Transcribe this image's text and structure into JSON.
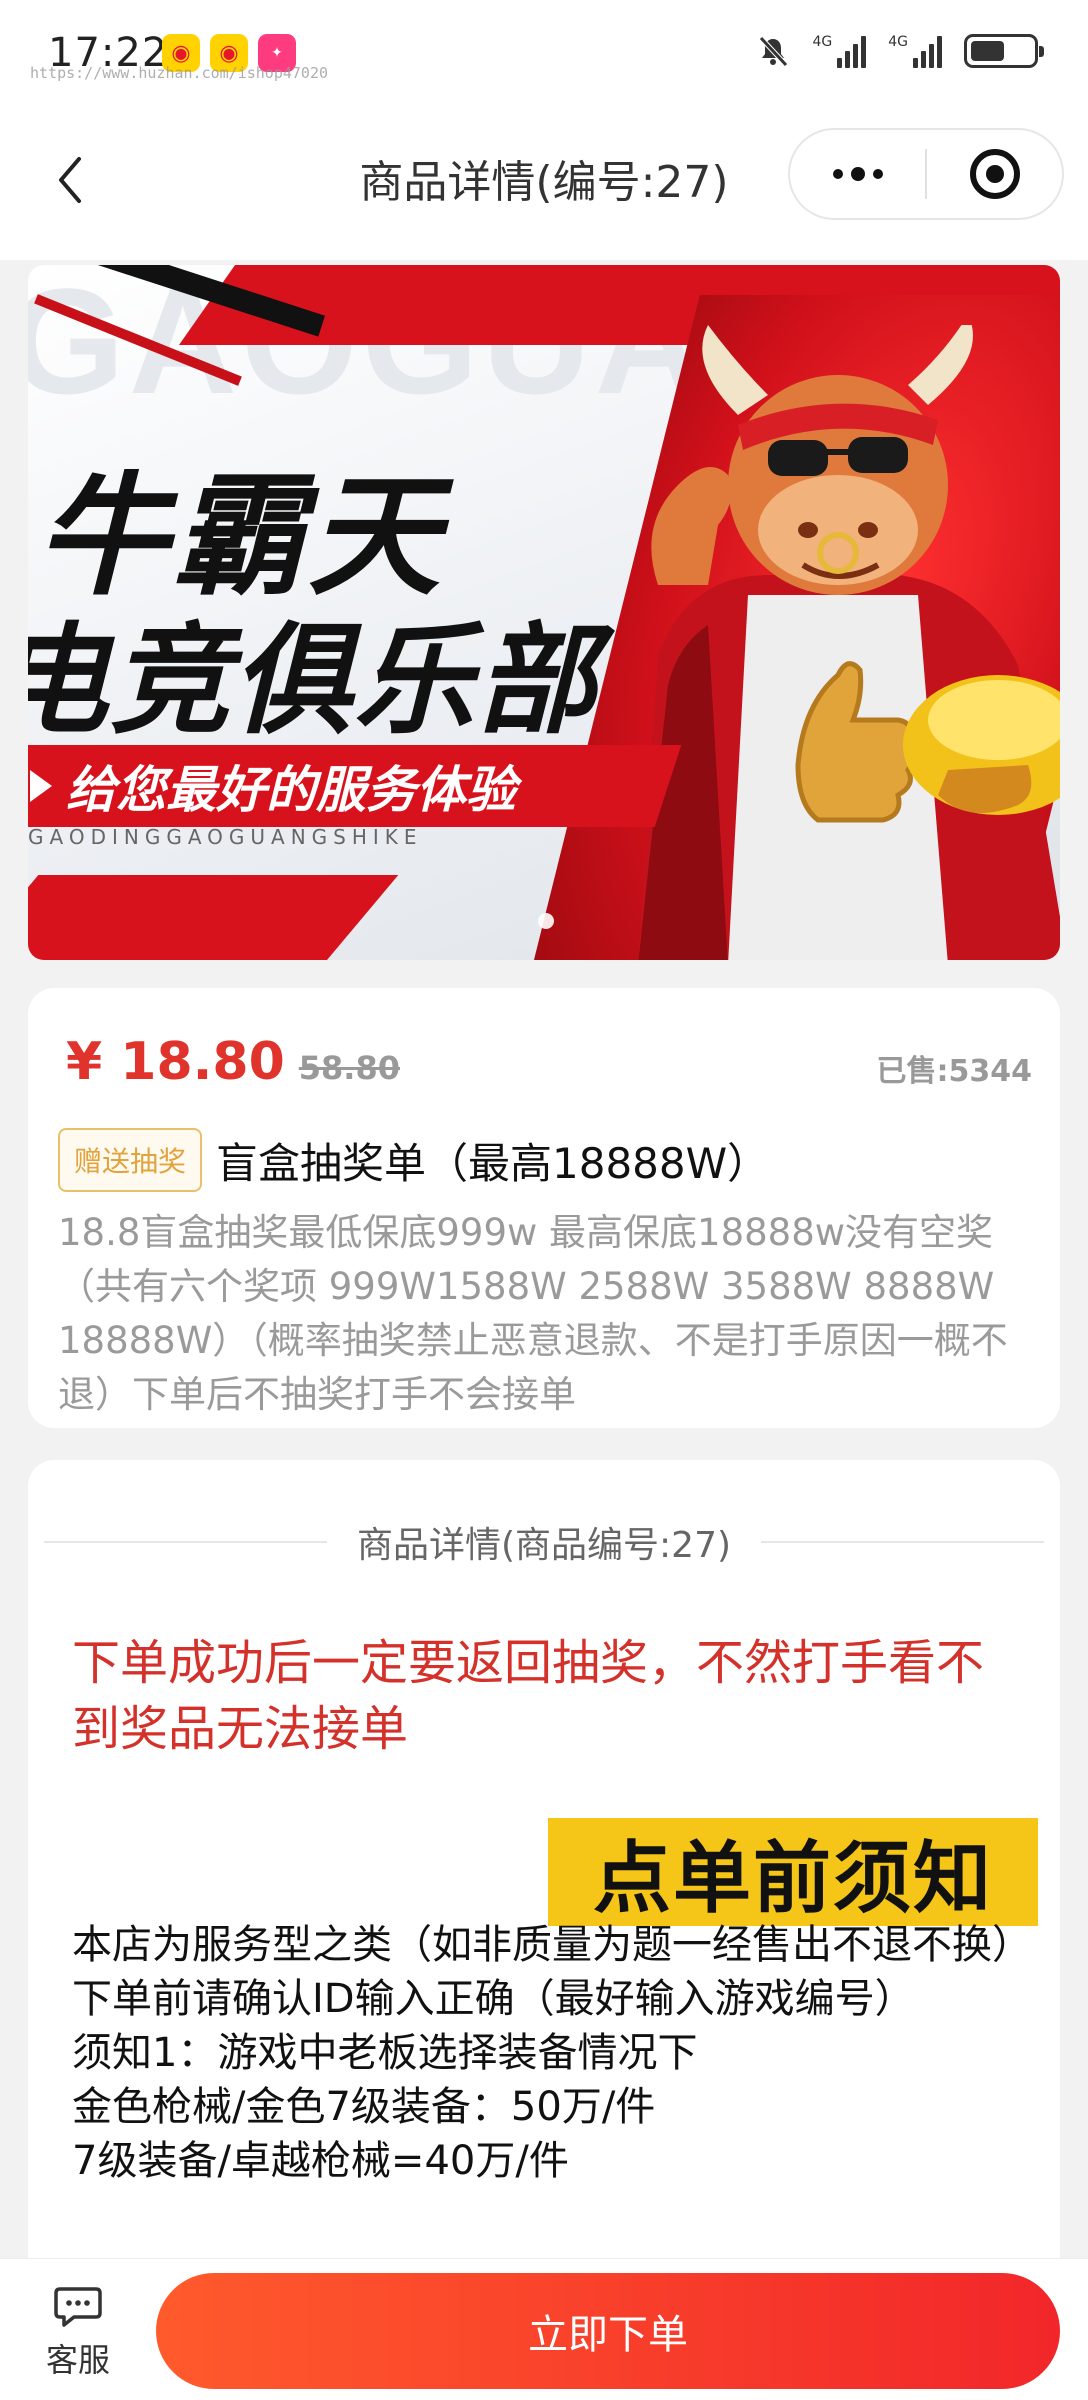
{
  "status_bar": {
    "time": "17:22",
    "url_overlay": "https://www.huzhan.com/ishop47020",
    "net1": "4G",
    "net2": "4G"
  },
  "nav": {
    "title": "商品详情(编号:27)",
    "icons": [
      "back-chevron-icon",
      "more-dots-icon",
      "target-icon"
    ]
  },
  "banner": {
    "title_line1": "牛霸天",
    "title_line2": "电竞俱乐部",
    "slogan": "给您最好的服务体验",
    "subtitle": "GAODINGGAOGUANGSHIKE",
    "watermark": "GAOGUANGSHI"
  },
  "product": {
    "price": "¥ 18.80",
    "original_price": "58.80",
    "sold": "已售:5344",
    "tag": "赠送抽奖",
    "title": "盲盒抽奖单（最高18888W）",
    "description": "18.8盲盒抽奖最低保底999w 最高保底18888w没有空奖（共有六个奖项 999W1588W 2588W 3588W 8888W 18888W）（概率抽奖禁止恶意退款、不是打手原因一概不退）下单后不抽奖打手不会接单"
  },
  "details": {
    "section_title": "商品详情(商品编号:27)",
    "red_notice": "下单成功后一定要返回抽奖，不然打手看不到奖品无法接单",
    "badge": "点单前须知",
    "lines": [
      "本店为服务型之类（如非质量为题一经售出不退不换）下单前请确认ID输入正确（最好输入游戏编号）",
      "须知1：游戏中老板选择装备情况下",
      "金色枪械/金色7级装备：50万/件",
      "7级装备/卓越枪械=40万/件"
    ]
  },
  "bottom_bar": {
    "service_label": "客服",
    "order_button": "立即下单"
  },
  "colors": {
    "accent_red": "#e0332b",
    "button_gradient_start": "#ff5a2c",
    "button_gradient_end": "#f2262a",
    "badge_yellow": "#f5c517",
    "tag_gold": "#e2a23c"
  }
}
